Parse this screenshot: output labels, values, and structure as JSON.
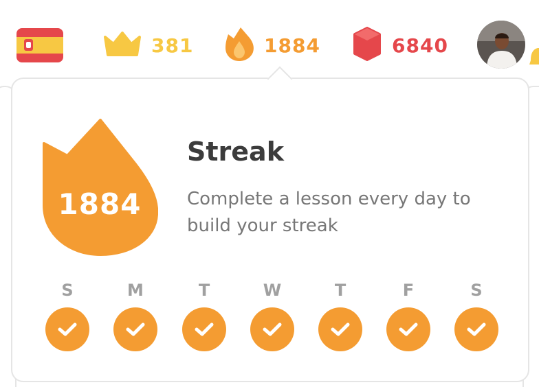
{
  "colors": {
    "accent_orange": "#f49c32",
    "crown_gold": "#f7c843",
    "gem_red": "#e5474b",
    "title_text": "#3c3c3c",
    "body_text": "#777777",
    "day_letter": "#a0a0a0"
  },
  "topbar": {
    "language_flag_icon": "spain-flag-icon",
    "crowns": {
      "icon": "crown-icon",
      "value": "381"
    },
    "streak": {
      "icon": "flame-icon",
      "value": "1884"
    },
    "gems": {
      "icon": "gem-icon",
      "value": "6840"
    },
    "avatar_icon": "user-avatar",
    "bell_icon": "bell-icon"
  },
  "streak_popover": {
    "count": "1884",
    "title": "Streak",
    "description": "Complete a lesson every day to build your streak",
    "days": [
      {
        "letter": "S",
        "completed": true
      },
      {
        "letter": "M",
        "completed": true
      },
      {
        "letter": "T",
        "completed": true
      },
      {
        "letter": "W",
        "completed": true
      },
      {
        "letter": "T",
        "completed": true
      },
      {
        "letter": "F",
        "completed": true
      },
      {
        "letter": "S",
        "completed": true
      }
    ]
  }
}
